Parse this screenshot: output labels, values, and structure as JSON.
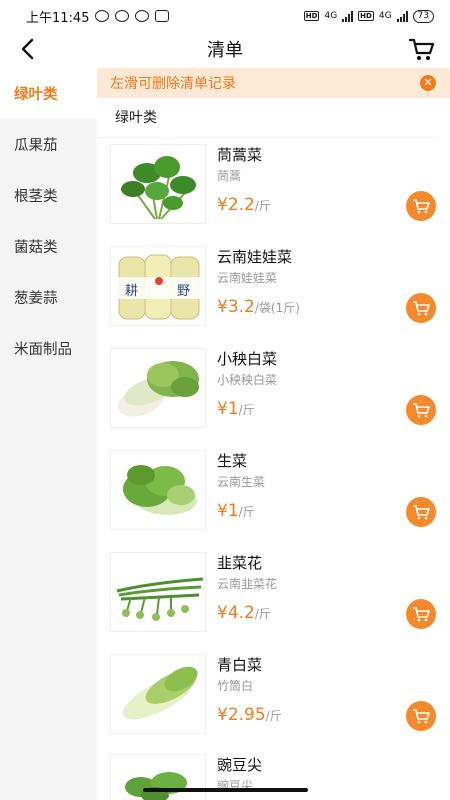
{
  "status_bar": {
    "time": "上午11:45",
    "hd1": "HD",
    "net1": "4G",
    "hd2": "HD",
    "net2": "4G",
    "battery": "73"
  },
  "nav": {
    "title": "清单"
  },
  "sidebar": {
    "items": [
      {
        "label": "绿叶类"
      },
      {
        "label": "瓜果茄"
      },
      {
        "label": "根茎类"
      },
      {
        "label": "菌菇类"
      },
      {
        "label": "葱姜蒜"
      },
      {
        "label": "米面制品"
      }
    ]
  },
  "banner": {
    "text": "左滑可删除清单记录"
  },
  "section": {
    "title": "绿叶类"
  },
  "products": [
    {
      "name": "茼蒿菜",
      "subtitle": "茼蒿",
      "price": "¥2.2",
      "unit": "/斤"
    },
    {
      "name": "云南娃娃菜",
      "subtitle": "云南娃娃菜",
      "price": "¥3.2",
      "unit": "/袋(1斤)",
      "package_text": [
        "耕",
        "野"
      ]
    },
    {
      "name": "小秧白菜",
      "subtitle": "小秧秧白菜",
      "price": "¥1",
      "unit": "/斤"
    },
    {
      "name": "生菜",
      "subtitle": "云南生菜",
      "price": "¥1",
      "unit": "/斤"
    },
    {
      "name": "韭菜花",
      "subtitle": "云南韭菜花",
      "price": "¥4.2",
      "unit": "/斤"
    },
    {
      "name": "青白菜",
      "subtitle": "竹筒白",
      "price": "¥2.95",
      "unit": "/斤"
    },
    {
      "name": "豌豆尖",
      "subtitle": "豌豆尖",
      "price": "",
      "unit": ""
    }
  ],
  "colors": {
    "accent": "#f07c1c",
    "banner_bg": "#fde9d6",
    "sidebar_bg": "#f5f5f5"
  }
}
